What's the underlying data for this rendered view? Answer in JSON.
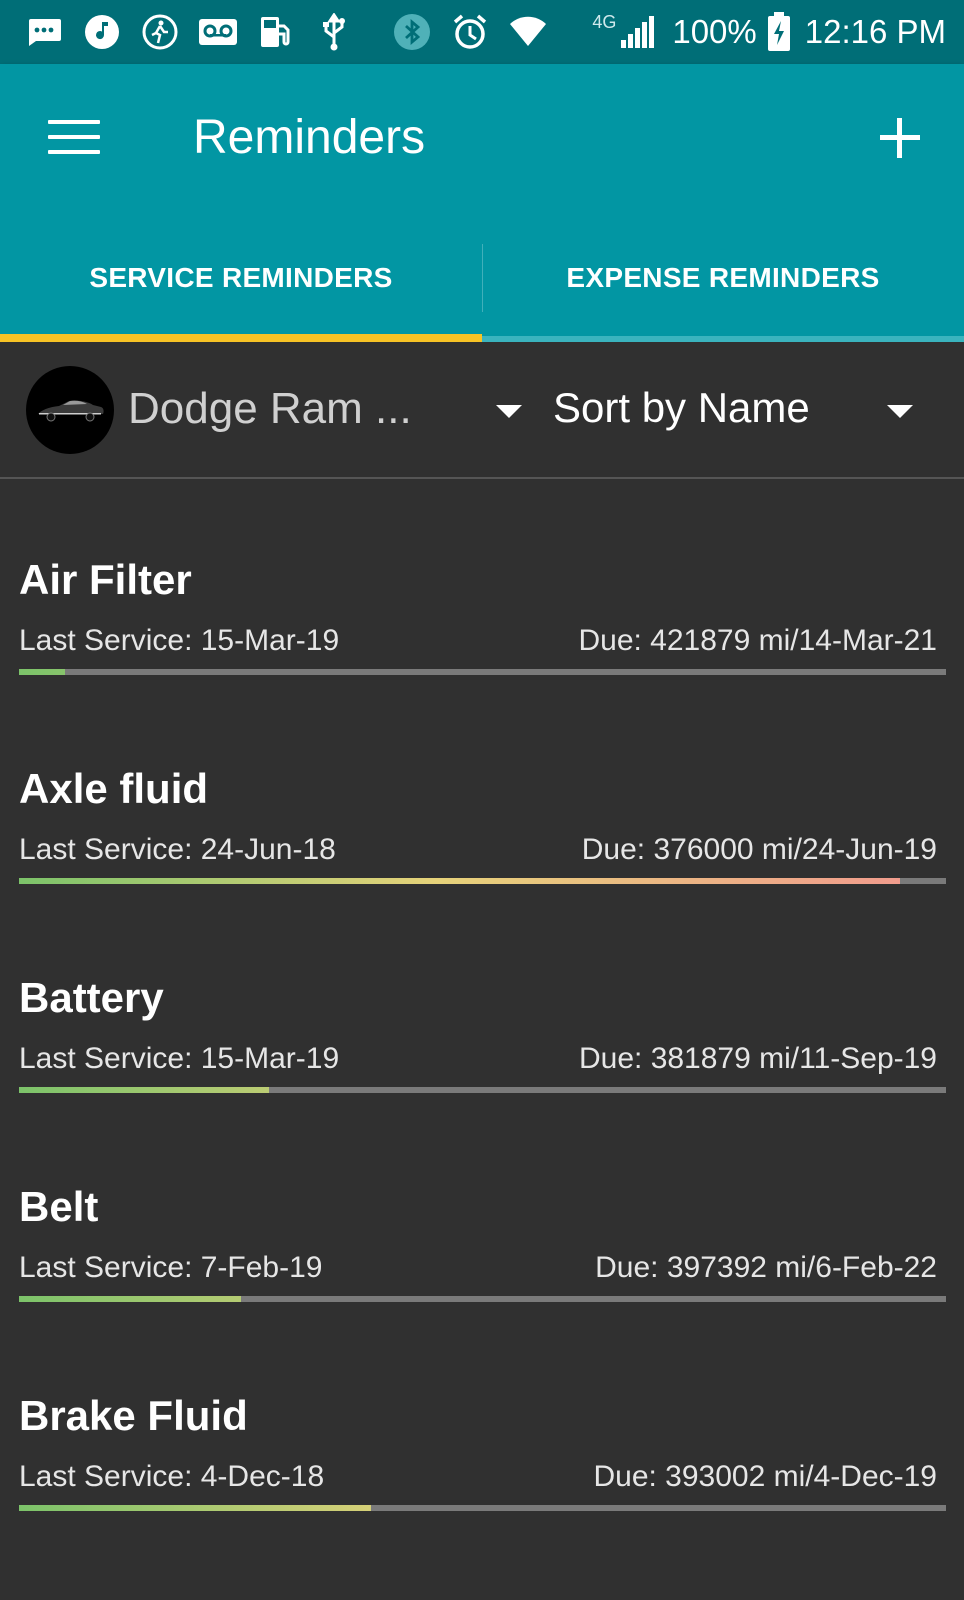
{
  "status_bar": {
    "battery_percent": "100%",
    "time": "12:16 PM",
    "network": "4G",
    "icons": [
      "message-icon",
      "music-icon",
      "fitness-icon",
      "voicemail-icon",
      "fuel-icon",
      "usb-icon",
      "bluetooth-icon",
      "alarm-icon",
      "wifi-icon",
      "signal-icon",
      "battery-charging-icon"
    ]
  },
  "appbar": {
    "title": "Reminders"
  },
  "tabs": [
    {
      "label": "SERVICE REMINDERS",
      "selected": true
    },
    {
      "label": "EXPENSE REMINDERS",
      "selected": false
    }
  ],
  "filter": {
    "vehicle": "Dodge Ram ...",
    "sort": "Sort by Name"
  },
  "reminders": [
    {
      "name": "Air Filter",
      "last": "Last Service: 15-Mar-19",
      "due": "Due: 421879 mi/14-Mar-21",
      "progress": 0.05
    },
    {
      "name": "Axle fluid",
      "last": "Last Service: 24-Jun-18",
      "due": "Due: 376000 mi/24-Jun-19",
      "progress": 0.95
    },
    {
      "name": "Battery",
      "last": "Last Service: 15-Mar-19",
      "due": "Due: 381879 mi/11-Sep-19",
      "progress": 0.27
    },
    {
      "name": "Belt",
      "last": "Last Service: 7-Feb-19",
      "due": "Due: 397392 mi/6-Feb-22",
      "progress": 0.24
    },
    {
      "name": "Brake Fluid",
      "last": "Last Service: 4-Dec-18",
      "due": "Due: 393002 mi/4-Dec-19",
      "progress": 0.38
    }
  ],
  "colors": {
    "appbar": "#0296a3",
    "statusbar": "#006e77",
    "tab_indicator": "#f7c325",
    "background": "#303030",
    "progress_green": "#7cc36a",
    "progress_yellow": "#e6d27a",
    "progress_red": "#f2978f"
  }
}
